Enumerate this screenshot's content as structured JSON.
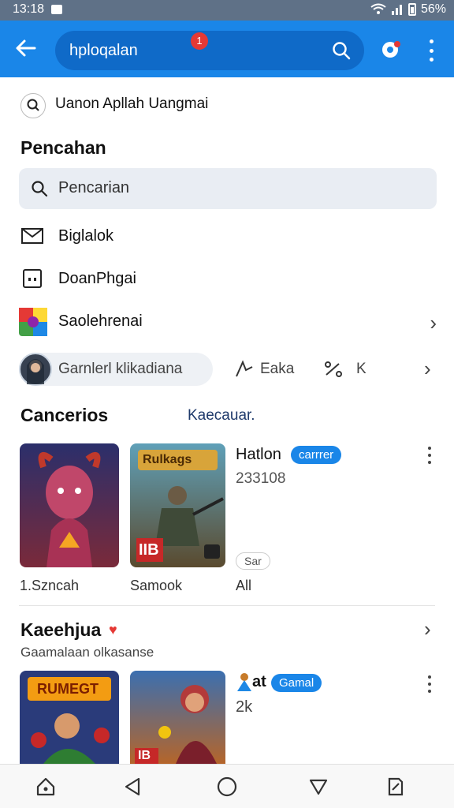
{
  "status_bar": {
    "time": "13:18",
    "battery": "56%"
  },
  "app_bar": {
    "query": "hploqalan",
    "badge_count": "1"
  },
  "recent": {
    "text": "Uanon Apllah Uangmai"
  },
  "search_section": {
    "title": "Pencahan",
    "field_placeholder": "Pencarian",
    "items": [
      {
        "label": "Biglalok",
        "icon": "mail-icon"
      },
      {
        "label": "DoanPhgai",
        "icon": "calendar-icon"
      },
      {
        "label": "Saolehrenai",
        "icon": "app-grid-icon"
      }
    ]
  },
  "filter_row": {
    "chip_label": "Garnlerl klikadiana",
    "item2": "Eaka",
    "item3": "K"
  },
  "section1": {
    "title": "Cancerios",
    "subtitle": "Kaecauar.",
    "cards": [
      {
        "caption": "1.Szncah"
      },
      {
        "caption": "Samook",
        "badge": "IIB",
        "art_text": "Rulkags"
      }
    ],
    "detail": {
      "title": "Hatlon",
      "tag": "carrrer",
      "count": "233108",
      "pill": "Sar",
      "footer": "All"
    }
  },
  "section2": {
    "title": "Kaeehjua",
    "subtitle": "Gaamalaan olkasanse",
    "cards": [
      {
        "art_text": "RUMEGT"
      },
      {
        "badge": "IB"
      }
    ],
    "detail": {
      "title": "at",
      "tag": "Gamal",
      "count": "2k"
    }
  },
  "colors": {
    "accent": "#1a86e8",
    "accent_dark": "#0f6ac8",
    "badge": "#e53935"
  }
}
